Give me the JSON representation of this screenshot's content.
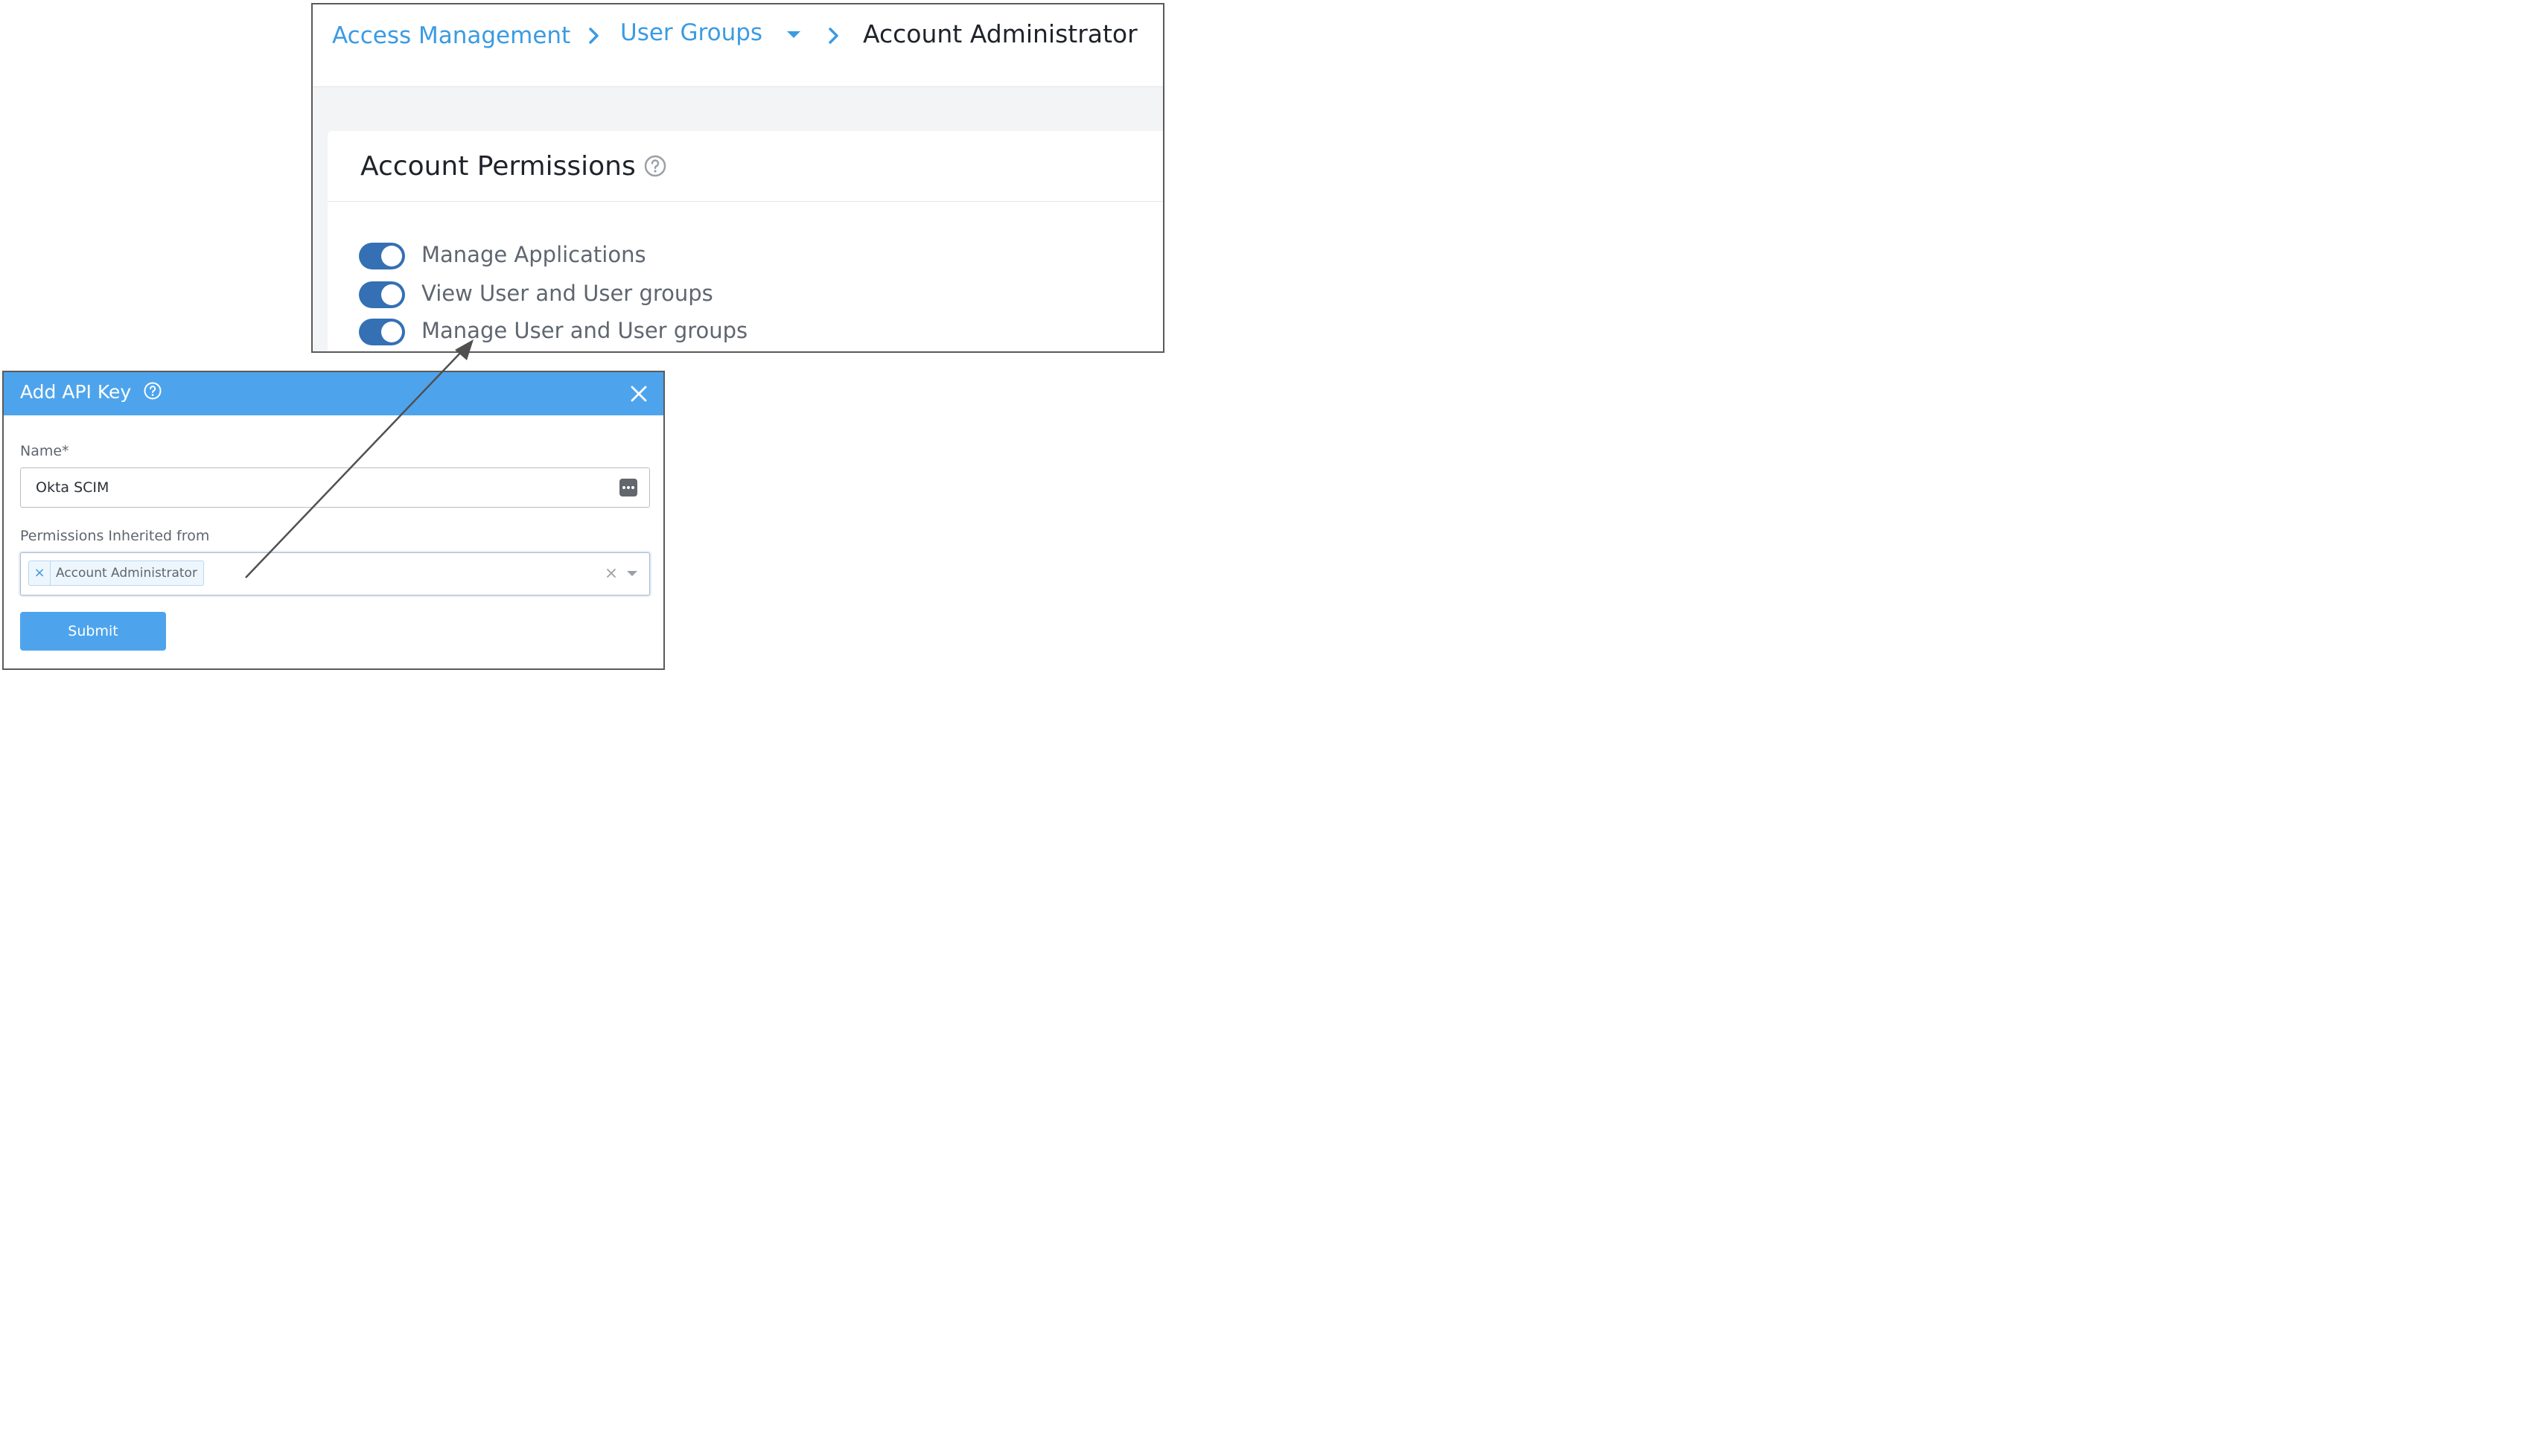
{
  "breadcrumb": {
    "items": [
      {
        "label": "Access Management"
      },
      {
        "label": "User Groups"
      },
      {
        "label": "Account Administrator"
      }
    ]
  },
  "account_permissions": {
    "title": "Account Permissions",
    "items": [
      {
        "label": "Manage Applications",
        "enabled": true
      },
      {
        "label": "View User and User groups",
        "enabled": true
      },
      {
        "label": "Manage User and User groups",
        "enabled": true
      }
    ]
  },
  "dialog": {
    "title": "Add API Key",
    "name_label": "Name*",
    "name_value": "Okta SCIM",
    "permissions_label": "Permissions Inherited from",
    "selected_tag": "Account Administrator",
    "submit_label": "Submit"
  },
  "colors": {
    "link": "#3a9be3",
    "toggle_on": "#3470b3",
    "dialog_header": "#4ea4ec",
    "submit": "#4ea4ec"
  },
  "icons": [
    "chevron-right-icon",
    "caret-down-icon",
    "help-icon",
    "close-icon",
    "password-dots-icon",
    "clear-icon"
  ]
}
